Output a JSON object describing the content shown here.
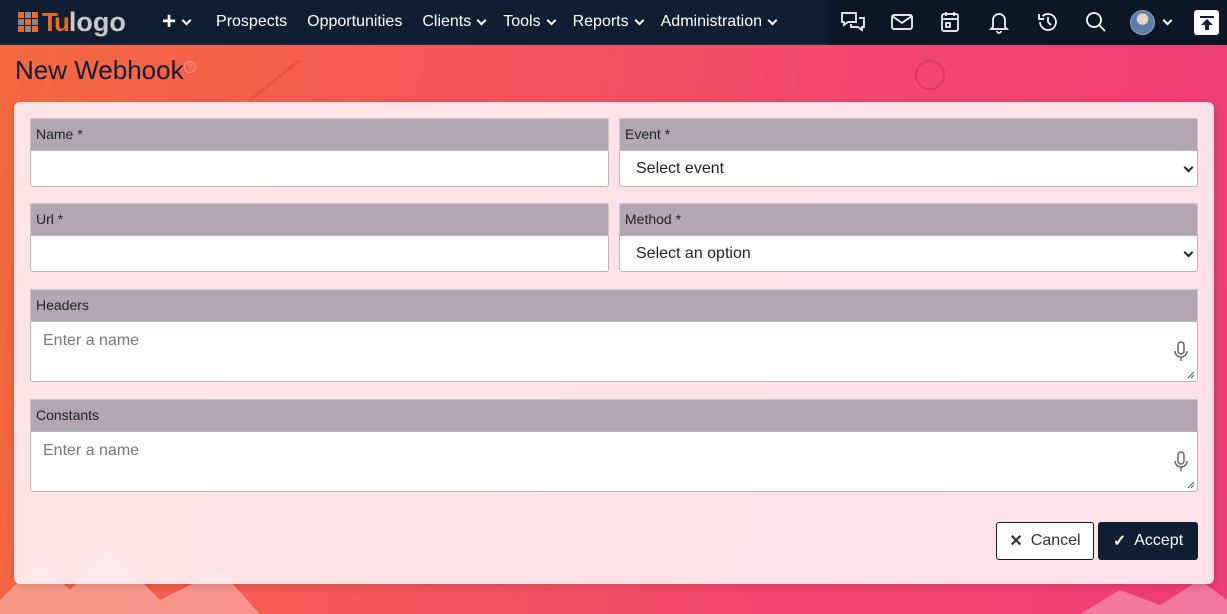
{
  "app": {
    "logo_tu": "Tu",
    "logo_text": "logo"
  },
  "nav": {
    "items": [
      {
        "label": "Prospects",
        "dropdown": false
      },
      {
        "label": "Opportunities",
        "dropdown": false
      },
      {
        "label": "Clients",
        "dropdown": true
      },
      {
        "label": "Tools",
        "dropdown": true
      },
      {
        "label": "Reports",
        "dropdown": true
      },
      {
        "label": "Administration",
        "dropdown": true
      }
    ],
    "right_icons": [
      "chat-icon",
      "mail-icon",
      "calendar-icon",
      "bell-icon",
      "history-icon",
      "search-icon"
    ]
  },
  "page": {
    "title": "New Webhook"
  },
  "form": {
    "name": {
      "label": "Name *",
      "value": ""
    },
    "event": {
      "label": "Event *",
      "selected": "Select event"
    },
    "url": {
      "label": "Url *",
      "value": ""
    },
    "method": {
      "label": "Method *",
      "selected": "Select an option"
    },
    "headers": {
      "label": "Headers",
      "placeholder": "Enter a name"
    },
    "constants": {
      "label": "Constants",
      "placeholder": "Enter a name"
    }
  },
  "actions": {
    "cancel_label": "Cancel",
    "accept_label": "Accept"
  },
  "colors": {
    "navbar": "#0f1e33",
    "label_bg": "#b2a6b3",
    "accent_orange": "#f06b1f",
    "bg_gradient_start": "#f46a3e",
    "bg_gradient_end": "#ee3c76"
  }
}
